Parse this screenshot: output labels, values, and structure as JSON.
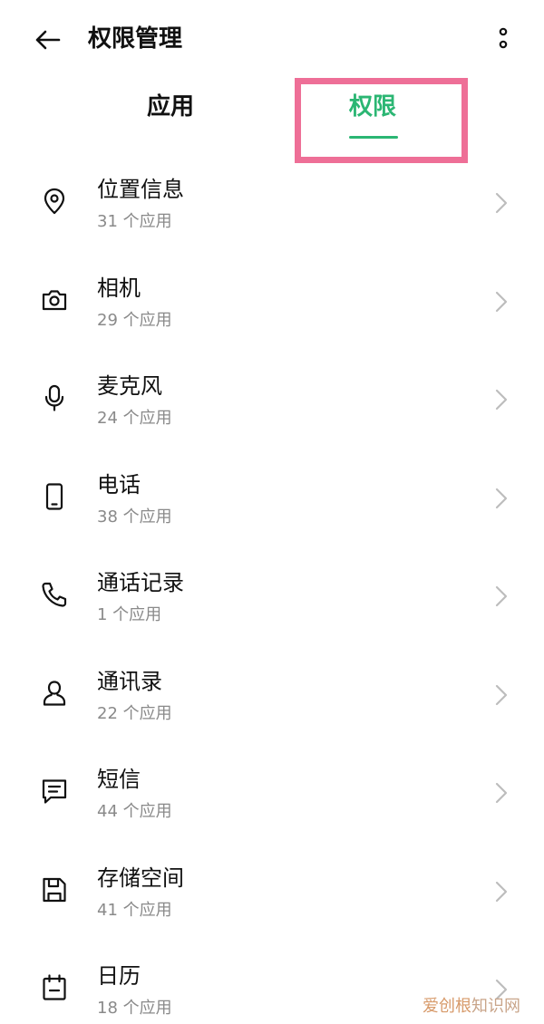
{
  "header": {
    "title": "权限管理",
    "back_icon": "arrow-left-icon",
    "more_icon": "more-vertical-icon"
  },
  "tabs": [
    {
      "label": "应用",
      "active": false
    },
    {
      "label": "权限",
      "active": true
    }
  ],
  "accent_color": "#2bb673",
  "highlight_color": "#ee6f97",
  "permissions": [
    {
      "label": "位置信息",
      "count": "31 个应用",
      "icon": "location-pin-icon"
    },
    {
      "label": "相机",
      "count": "29 个应用",
      "icon": "camera-icon"
    },
    {
      "label": "麦克风",
      "count": "24 个应用",
      "icon": "microphone-icon"
    },
    {
      "label": "电话",
      "count": "38 个应用",
      "icon": "phone-device-icon"
    },
    {
      "label": "通话记录",
      "count": "1 个应用",
      "icon": "call-log-icon"
    },
    {
      "label": "通讯录",
      "count": "22 个应用",
      "icon": "contacts-icon"
    },
    {
      "label": "短信",
      "count": "44 个应用",
      "icon": "message-icon"
    },
    {
      "label": "存储空间",
      "count": "41 个应用",
      "icon": "storage-icon"
    },
    {
      "label": "日历",
      "count": "18 个应用",
      "icon": "calendar-icon"
    }
  ],
  "watermark": {
    "part1": "爱创根",
    "part2": "知识网"
  }
}
